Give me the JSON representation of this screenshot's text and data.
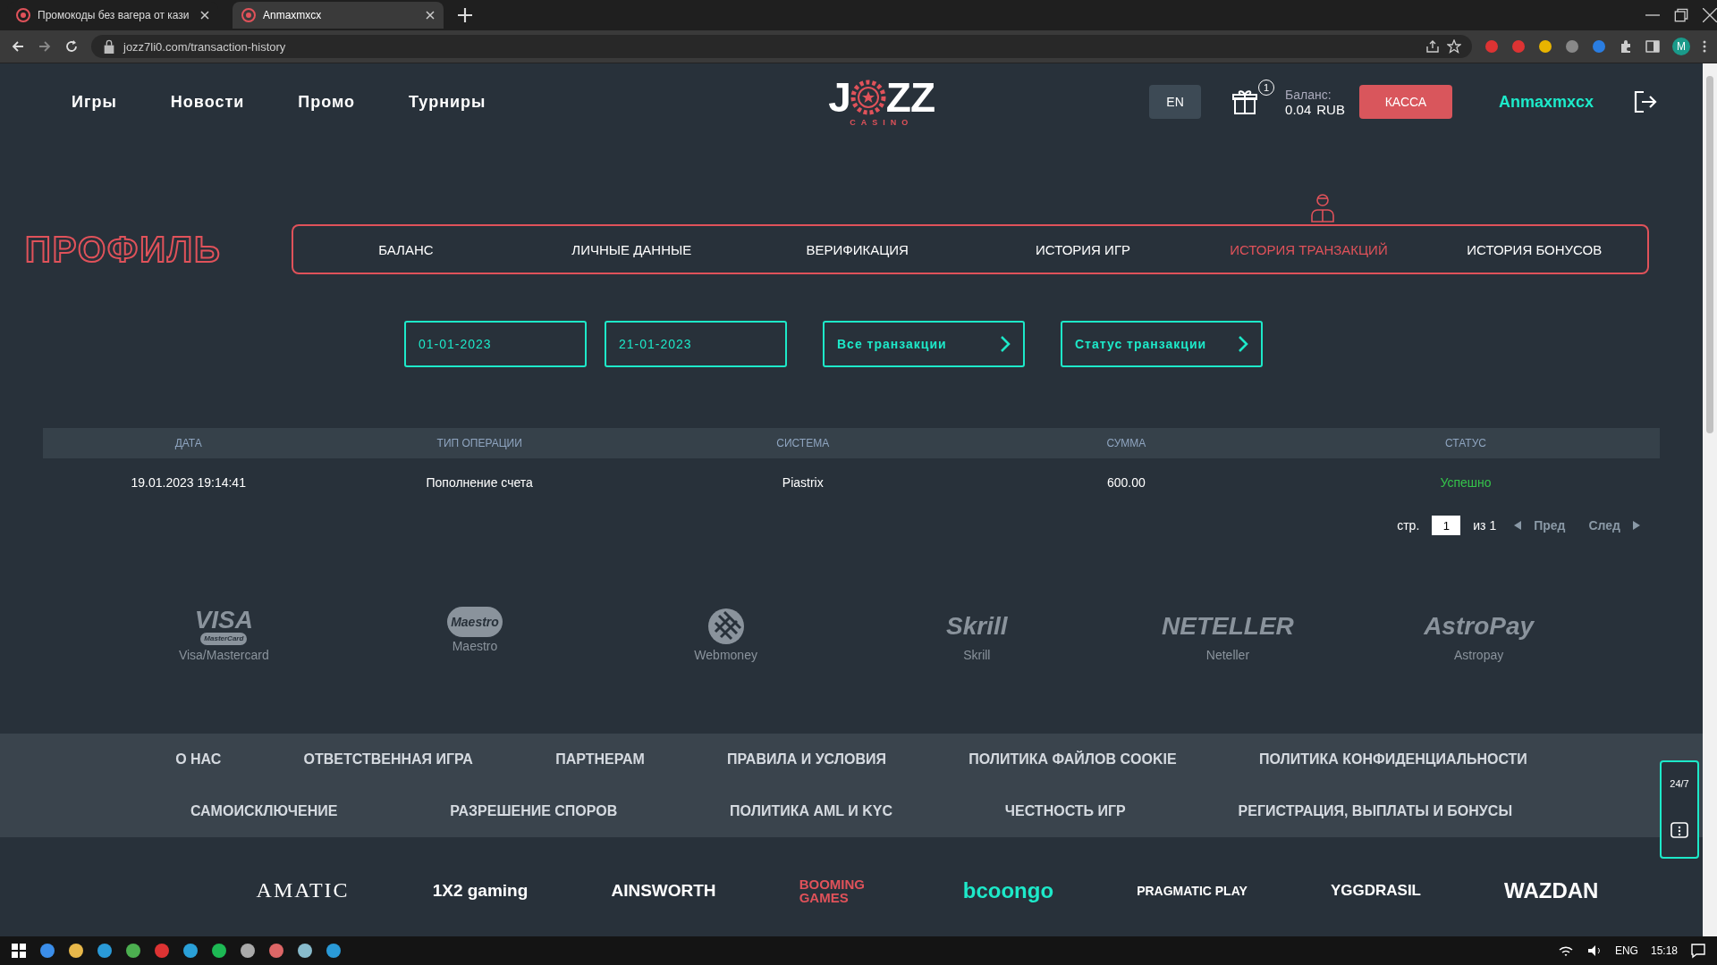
{
  "browser": {
    "tabs": [
      {
        "title": "Промокоды без вагера от кази",
        "selected": false
      },
      {
        "title": "Anmaxmxcx",
        "selected": true
      }
    ],
    "url": "jozz7li0.com/transaction-history",
    "profile_initial": "M"
  },
  "site_nav": [
    "Игры",
    "Новости",
    "Промо",
    "Турниры"
  ],
  "logo": {
    "left": "J",
    "right": "ZZ",
    "sub": "CASINO"
  },
  "header": {
    "lang": "EN",
    "gift_count": "1",
    "balance_label": "Баланс:",
    "balance_amount": "0.04",
    "balance_currency": "RUB",
    "cashier": "КАССА",
    "username": "Anmaxmxcx"
  },
  "profile_title": "ПРОФИЛЬ",
  "profile_tabs": [
    {
      "label": "БАЛАНС",
      "selected": false
    },
    {
      "label": "ЛИЧНЫЕ ДАННЫЕ",
      "selected": false
    },
    {
      "label": "ВЕРИФИКАЦИЯ",
      "selected": false
    },
    {
      "label": "ИСТОРИЯ ИГР",
      "selected": false
    },
    {
      "label": "ИСТОРИЯ ТРАНЗАКЦИЙ",
      "selected": true
    },
    {
      "label": "ИСТОРИЯ БОНУСОВ",
      "selected": false
    }
  ],
  "filters": [
    {
      "kind": "date",
      "value": "01-01-2023"
    },
    {
      "kind": "date",
      "value": "21-01-2023"
    },
    {
      "kind": "select",
      "label": "Все транзакции"
    },
    {
      "kind": "select",
      "label": "Статус транзакции"
    }
  ],
  "table": {
    "columns": [
      "ДАТА",
      "ТИП ОПЕРАЦИИ",
      "СИСТЕМА",
      "СУММА",
      "СТАТУС"
    ],
    "rows": [
      {
        "cells": [
          "19.01.2023 19:14:41",
          "Пополнение счета",
          "Piastrix",
          "600.00"
        ],
        "status": "Успешно",
        "color": "#35c24a"
      }
    ]
  },
  "pagination": {
    "label": "стр.",
    "page": "1",
    "of": "из 1",
    "prev": "Пред",
    "next": "След"
  },
  "payments": [
    {
      "logo": "VISA",
      "logo2": "MasterCard",
      "caption": "Visa/Mastercard"
    },
    {
      "logo": "Maestro",
      "caption": "Maestro"
    },
    {
      "caption": "Webmoney"
    },
    {
      "logo": "Skrill",
      "caption": "Skrill"
    },
    {
      "logo": "NETELLER",
      "caption": "Neteller"
    },
    {
      "logo": "AstroPay",
      "caption": "Astropay"
    }
  ],
  "footer_links": [
    [
      "О НАС",
      "ОТВЕТСТВЕННАЯ ИГРА",
      "ПАРТНЕРАМ",
      "ПРАВИЛА И УСЛОВИЯ",
      "ПОЛИТИКА ФАЙЛОВ COOKIE",
      "ПОЛИТИКА КОНФИДЕНЦИАЛЬНОСТИ"
    ],
    [
      "САМОИСКЛЮЧЕНИЕ",
      "РАЗРЕШЕНИЕ СПОРОВ",
      "ПОЛИТИКА AML И KYC",
      "ЧЕСТНОСТЬ ИГР",
      "РЕГИСТРАЦИЯ, ВЫПЛАТЫ И БОНУСЫ"
    ]
  ],
  "support": "24/7",
  "providers": [
    "AMATIC",
    "1X2 gaming",
    "AINSWORTH",
    "BOOMING GAMES",
    "bcoongo",
    "PRAGMATIC PLAY",
    "YGGDRASIL",
    "WAZDAN"
  ],
  "taskbar": {
    "lang": "ENG",
    "time": "15:18"
  }
}
